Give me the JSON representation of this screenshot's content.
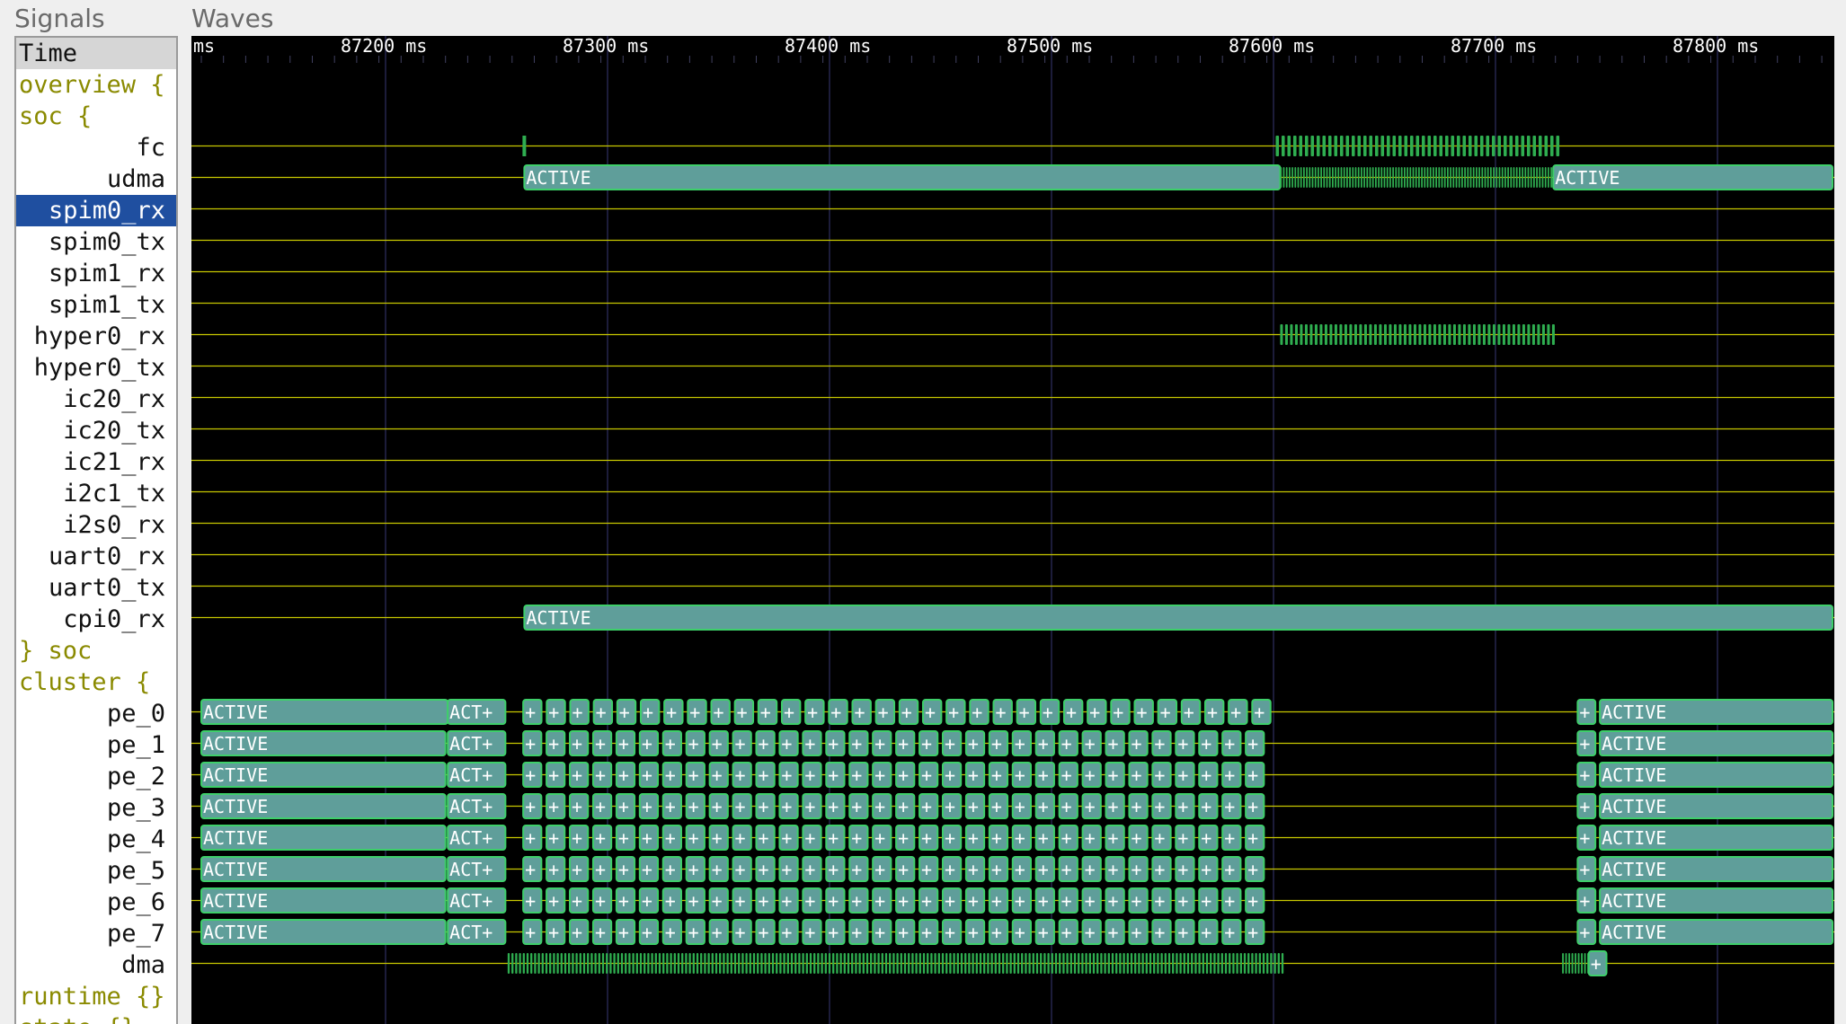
{
  "panels": {
    "signals_title": "Signals",
    "waves_title": "Waves"
  },
  "signals": [
    {
      "label": "Time",
      "kind": "time"
    },
    {
      "label": "overview {",
      "kind": "group"
    },
    {
      "label": "soc {",
      "kind": "group"
    },
    {
      "label": "fc",
      "kind": "leaf"
    },
    {
      "label": "udma",
      "kind": "leaf"
    },
    {
      "label": "spim0_rx",
      "kind": "leaf",
      "selected": true
    },
    {
      "label": "spim0_tx",
      "kind": "leaf"
    },
    {
      "label": "spim1_rx",
      "kind": "leaf"
    },
    {
      "label": "spim1_tx",
      "kind": "leaf"
    },
    {
      "label": "hyper0_rx",
      "kind": "leaf"
    },
    {
      "label": "hyper0_tx",
      "kind": "leaf"
    },
    {
      "label": "ic20_rx",
      "kind": "leaf"
    },
    {
      "label": "ic20_tx",
      "kind": "leaf"
    },
    {
      "label": "ic21_rx",
      "kind": "leaf"
    },
    {
      "label": "i2c1_tx",
      "kind": "leaf"
    },
    {
      "label": "i2s0_rx",
      "kind": "leaf"
    },
    {
      "label": "uart0_rx",
      "kind": "leaf"
    },
    {
      "label": "uart0_tx",
      "kind": "leaf"
    },
    {
      "label": "cpi0_rx",
      "kind": "leaf"
    },
    {
      "label": "} soc",
      "kind": "group"
    },
    {
      "label": "cluster {",
      "kind": "group"
    },
    {
      "label": "pe_0",
      "kind": "leaf"
    },
    {
      "label": "pe_1",
      "kind": "leaf"
    },
    {
      "label": "pe_2",
      "kind": "leaf"
    },
    {
      "label": "pe_3",
      "kind": "leaf"
    },
    {
      "label": "pe_4",
      "kind": "leaf"
    },
    {
      "label": "pe_5",
      "kind": "leaf"
    },
    {
      "label": "pe_6",
      "kind": "leaf"
    },
    {
      "label": "pe_7",
      "kind": "leaf"
    },
    {
      "label": "dma",
      "kind": "leaf"
    },
    {
      "label": "runtime {}",
      "kind": "group"
    },
    {
      "label": "state {}",
      "kind": "group"
    }
  ],
  "timeline": {
    "unit": "ms",
    "tick_values": [
      87200,
      87300,
      87400,
      87500,
      87600,
      87700,
      87800
    ],
    "tick_labels": [
      "87200 ms",
      "87300 ms",
      "87400 ms",
      "87500 ms",
      "87600 ms",
      "87700 ms",
      "87800 ms"
    ],
    "left_clip_label": "ms",
    "visible_range_ms": [
      87117,
      87857
    ]
  },
  "traces": {
    "fc": {
      "pulses": [
        {
          "t": 87262.5
        }
      ],
      "burst": {
        "start": 87601,
        "end": 87728,
        "label": ""
      }
    },
    "udma": {
      "segments": [
        {
          "start": 87262.5,
          "end": 87603,
          "label": "ACTIVE"
        },
        {
          "start": 87603,
          "end": 87726,
          "label": "",
          "busy": true
        },
        {
          "start": 87726,
          "end": 87857,
          "label": "ACTIVE"
        }
      ]
    },
    "hyper0_rx": {
      "burst": {
        "start": 87603,
        "end": 87726,
        "label": ""
      }
    },
    "cpi0_rx": {
      "segments": [
        {
          "start": 87262.5,
          "end": 87857,
          "label": "ACTIVE"
        }
      ]
    },
    "pe_0": {
      "active_until": 87228,
      "act_plus": {
        "start": 87228,
        "end": 87254,
        "label": "ACT+"
      },
      "plus_start": 87262,
      "plus_end": 87601,
      "plus_count": 32,
      "plus_label": "+",
      "tail_plus": {
        "start": 87737,
        "end": 87745,
        "label": "+"
      },
      "active_from": {
        "start": 87747,
        "end": 87857,
        "label": "ACTIVE"
      }
    },
    "pe_x": {
      "active_until": 87227,
      "act_plus": {
        "start": 87228,
        "end": 87254,
        "label": "ACT+"
      },
      "plus_start": 87262,
      "plus_end": 87598,
      "plus_count": 32,
      "plus_label": "+",
      "tail_plus": {
        "start": 87737,
        "end": 87745,
        "label": "+"
      },
      "active_from": {
        "start": 87747,
        "end": 87857,
        "label": "ACTIVE"
      }
    },
    "dma": {
      "burst": {
        "start": 87255,
        "end": 87604,
        "label": ""
      },
      "tail_burst": {
        "start": 87730,
        "end": 87743
      },
      "tail_plus": {
        "start": 87742,
        "end": 87750,
        "label": "+"
      }
    }
  },
  "colors": {
    "wave_background": "#000000",
    "trace_line": "#c8c800",
    "active_fill": "#5f9e9a",
    "active_edge": "#3ecf6a",
    "burst_fill": "#2fae50",
    "grid": "#1c1c3a",
    "group_text": "#8a8a00",
    "selection": "#1f4fa0"
  }
}
